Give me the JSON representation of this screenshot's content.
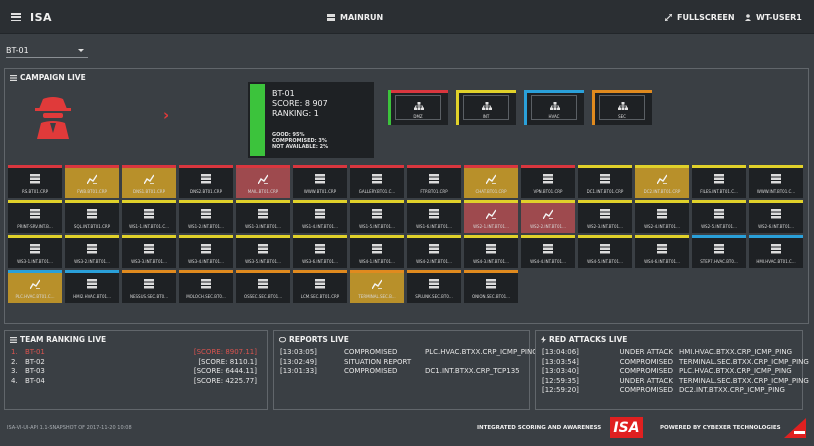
{
  "header": {
    "brand": "ISA",
    "mainrun": "MAINRUN",
    "fullscreen": "FULLSCREEN",
    "user": "WT-USER1"
  },
  "team_select": {
    "value": "BT-01"
  },
  "campaign": {
    "title": "CAMPAIGN LIVE",
    "summary": {
      "team": "BT-01",
      "score": "SCORE: 8 907",
      "ranking": "RANKING: 1",
      "good": "GOOD: 95%",
      "compromised": "COMPROMISED: 3%",
      "not_available": "NOT AVAILABLE: 2%"
    },
    "zones": [
      {
        "label": "DMZ",
        "color": "#d9363e"
      },
      {
        "label": "INT",
        "color": "#e0d12a"
      },
      {
        "label": "HVAC",
        "color": "#2aa0d9"
      },
      {
        "label": "SEC",
        "color": "#e08a1e"
      }
    ],
    "hosts": [
      [
        {
          "label": "RS.BT01.CRP",
          "state": "normal",
          "color": "#d9363e"
        },
        {
          "label": "FWB.BT01.CRP",
          "state": "gold",
          "color": "#d9363e"
        },
        {
          "label": "DNS1.BT01.CRP",
          "state": "gold",
          "color": "#d9363e"
        },
        {
          "label": "DNS2.BT01.CRP",
          "state": "normal",
          "color": "#d9363e"
        },
        {
          "label": "MAIL.BT01.CRP",
          "state": "maroon",
          "color": "#d9363e"
        },
        {
          "label": "WWW.BT01.CRP",
          "state": "normal",
          "color": "#d9363e"
        },
        {
          "label": "GALLERY.BT01.C...",
          "state": "normal",
          "color": "#d9363e"
        },
        {
          "label": "FTP.BT01.CRP",
          "state": "normal",
          "color": "#d9363e"
        },
        {
          "label": "CHAT.BT01.CRP",
          "state": "gold",
          "color": "#d9363e"
        },
        {
          "label": "VPN.BT01.CRP",
          "state": "normal",
          "color": "#d9363e"
        },
        {
          "label": "DC1.INT.BT01.CRP",
          "state": "normal",
          "color": "#e0d12a"
        },
        {
          "label": "DC2.INT.BT01.CRP",
          "state": "gold",
          "color": "#e0d12a"
        },
        {
          "label": "FILES.INT.BT01.C...",
          "state": "normal",
          "color": "#e0d12a"
        },
        {
          "label": "WWW.INT.BT01.C...",
          "state": "normal",
          "color": "#e0d12a"
        }
      ],
      [
        {
          "label": "PRINT-SRV.INT.B...",
          "state": "normal",
          "color": "#e0d12a"
        },
        {
          "label": "SQL.INT.BT01.CRP",
          "state": "normal",
          "color": "#e0d12a"
        },
        {
          "label": "WS1-1.INT.BT01.C...",
          "state": "normal",
          "color": "#e0d12a"
        },
        {
          "label": "WS1-2.INT.BT01...",
          "state": "normal",
          "color": "#e0d12a"
        },
        {
          "label": "WS1-3.INT.BT01...",
          "state": "normal",
          "color": "#e0d12a"
        },
        {
          "label": "WS1-4.INT.BT01...",
          "state": "normal",
          "color": "#e0d12a"
        },
        {
          "label": "WS1-5.INT.BT01...",
          "state": "normal",
          "color": "#e0d12a"
        },
        {
          "label": "WS1-6.INT.BT01...",
          "state": "normal",
          "color": "#e0d12a"
        },
        {
          "label": "WS2-1.INT.BT01...",
          "state": "maroon",
          "color": "#e0d12a"
        },
        {
          "label": "WS2-2.INT.BT01...",
          "state": "maroon",
          "color": "#e0d12a"
        },
        {
          "label": "WS2-3.INT.BT01...",
          "state": "normal",
          "color": "#e0d12a"
        },
        {
          "label": "WS2-4.INT.BT01...",
          "state": "normal",
          "color": "#e0d12a"
        },
        {
          "label": "WS2-5.INT.BT01...",
          "state": "normal",
          "color": "#e0d12a"
        },
        {
          "label": "WS2-6.INT.BT01...",
          "state": "normal",
          "color": "#e0d12a"
        }
      ],
      [
        {
          "label": "WS3-1.INT.BT01...",
          "state": "normal",
          "color": "#e0d12a"
        },
        {
          "label": "WS3-2.INT.BT01...",
          "state": "normal",
          "color": "#e0d12a"
        },
        {
          "label": "WS3-3.INT.BT01...",
          "state": "normal",
          "color": "#e0d12a"
        },
        {
          "label": "WS3-4.INT.BT01...",
          "state": "normal",
          "color": "#e0d12a"
        },
        {
          "label": "WS3-5.INT.BT01...",
          "state": "normal",
          "color": "#e0d12a"
        },
        {
          "label": "WS3-6.INT.BT01...",
          "state": "normal",
          "color": "#e0d12a"
        },
        {
          "label": "WS4-1.INT.BT01...",
          "state": "normal",
          "color": "#e0d12a"
        },
        {
          "label": "WS4-2.INT.BT01...",
          "state": "normal",
          "color": "#e0d12a"
        },
        {
          "label": "WS4-3.INT.BT01...",
          "state": "normal",
          "color": "#e0d12a"
        },
        {
          "label": "WS4-4.INT.BT01...",
          "state": "normal",
          "color": "#e0d12a"
        },
        {
          "label": "WS4-5.INT.BT01...",
          "state": "normal",
          "color": "#e0d12a"
        },
        {
          "label": "WS4-6.INT.BT01...",
          "state": "normal",
          "color": "#e0d12a"
        },
        {
          "label": "STEP7.HVAC.BT0...",
          "state": "normal",
          "color": "#2aa0d9"
        },
        {
          "label": "HMI.HVAC.BT01.C...",
          "state": "normal",
          "color": "#2aa0d9"
        }
      ],
      [
        {
          "label": "PLC.HVAC.BT01.C...",
          "state": "gold",
          "color": "#2aa0d9"
        },
        {
          "label": "HMI2.HVAC.BT01...",
          "state": "normal",
          "color": "#2aa0d9"
        },
        {
          "label": "NESSUS.SEC.BT0...",
          "state": "normal",
          "color": "#e08a1e"
        },
        {
          "label": "MOLOCH.SEC.BT0...",
          "state": "normal",
          "color": "#e08a1e"
        },
        {
          "label": "OSSEC.SEC.BT01...",
          "state": "normal",
          "color": "#e08a1e"
        },
        {
          "label": "LCM.SEC.BT01.CRP",
          "state": "normal",
          "color": "#e08a1e"
        },
        {
          "label": "TERMINAL.SEC.B...",
          "state": "gold",
          "color": "#e08a1e"
        },
        {
          "label": "SPLUNK.SEC.BT0...",
          "state": "normal",
          "color": "#e08a1e"
        },
        {
          "label": "ONION.SEC.BT01...",
          "state": "normal",
          "color": "#e08a1e"
        }
      ]
    ]
  },
  "ranking": {
    "title": "TEAM RANKING LIVE",
    "rows": [
      {
        "n": "1.",
        "team": "BT-01",
        "score": "[SCORE: 8907.11]"
      },
      {
        "n": "2.",
        "team": "BT-02",
        "score": "[SCORE: 8110.1]"
      },
      {
        "n": "3.",
        "team": "BT-03",
        "score": "[SCORE: 6444.11]"
      },
      {
        "n": "4.",
        "team": "BT-04",
        "score": "[SCORE: 4225.77]"
      }
    ]
  },
  "reports": {
    "title": "REPORTS LIVE",
    "rows": [
      {
        "time": "[13:03:05]",
        "status": "COMPROMISED",
        "target": "PLC.HVAC.BTXX.CRP_ICMP_PING"
      },
      {
        "time": "[13:02:49]",
        "status": "SITUATION REPORT",
        "target": ""
      },
      {
        "time": "[13:01:33]",
        "status": "COMPROMISED",
        "target": "DC1.INT.BTXX.CRP_TCP135"
      }
    ]
  },
  "attacks": {
    "title": "RED ATTACKS LIVE",
    "rows": [
      {
        "time": "[13:04:06]",
        "status": "UNDER ATTACK",
        "target": "HMI.HVAC.BTXX.CRP_ICMP_PING"
      },
      {
        "time": "[13:03:54]",
        "status": "COMPROMISED",
        "target": "TERMINAL.SEC.BTXX.CRP_ICMP_PING"
      },
      {
        "time": "[13:03:40]",
        "status": "COMPROMISED",
        "target": "PLC.HVAC.BTXX.CRP_ICMP_PING"
      },
      {
        "time": "[12:59:35]",
        "status": "UNDER ATTACK",
        "target": "TERMINAL.SEC.BTXX.CRP_ICMP_PING"
      },
      {
        "time": "[12:59:20]",
        "status": "COMPROMISED",
        "target": "DC2.INT.BTXX.CRP_ICMP_PING"
      }
    ]
  },
  "footer": {
    "version": "ISA-VI-UI-API 1.1-SNAPSHOT OF 2017-11-20 10:08",
    "tagline": "INTEGRATED SCORING AND AWARENESS",
    "logo": "ISA",
    "powered": "POWERED BY CYBEXER TECHNOLOGIES",
    "cyb_logo_text": "CYBEXER"
  },
  "colors": {
    "gold_tile": "#b8902a",
    "maroon_tile": "#9e4a4e",
    "good_bar": "#3cc33c",
    "accent_red": "#e02020",
    "rank_first": "#d9534f"
  }
}
